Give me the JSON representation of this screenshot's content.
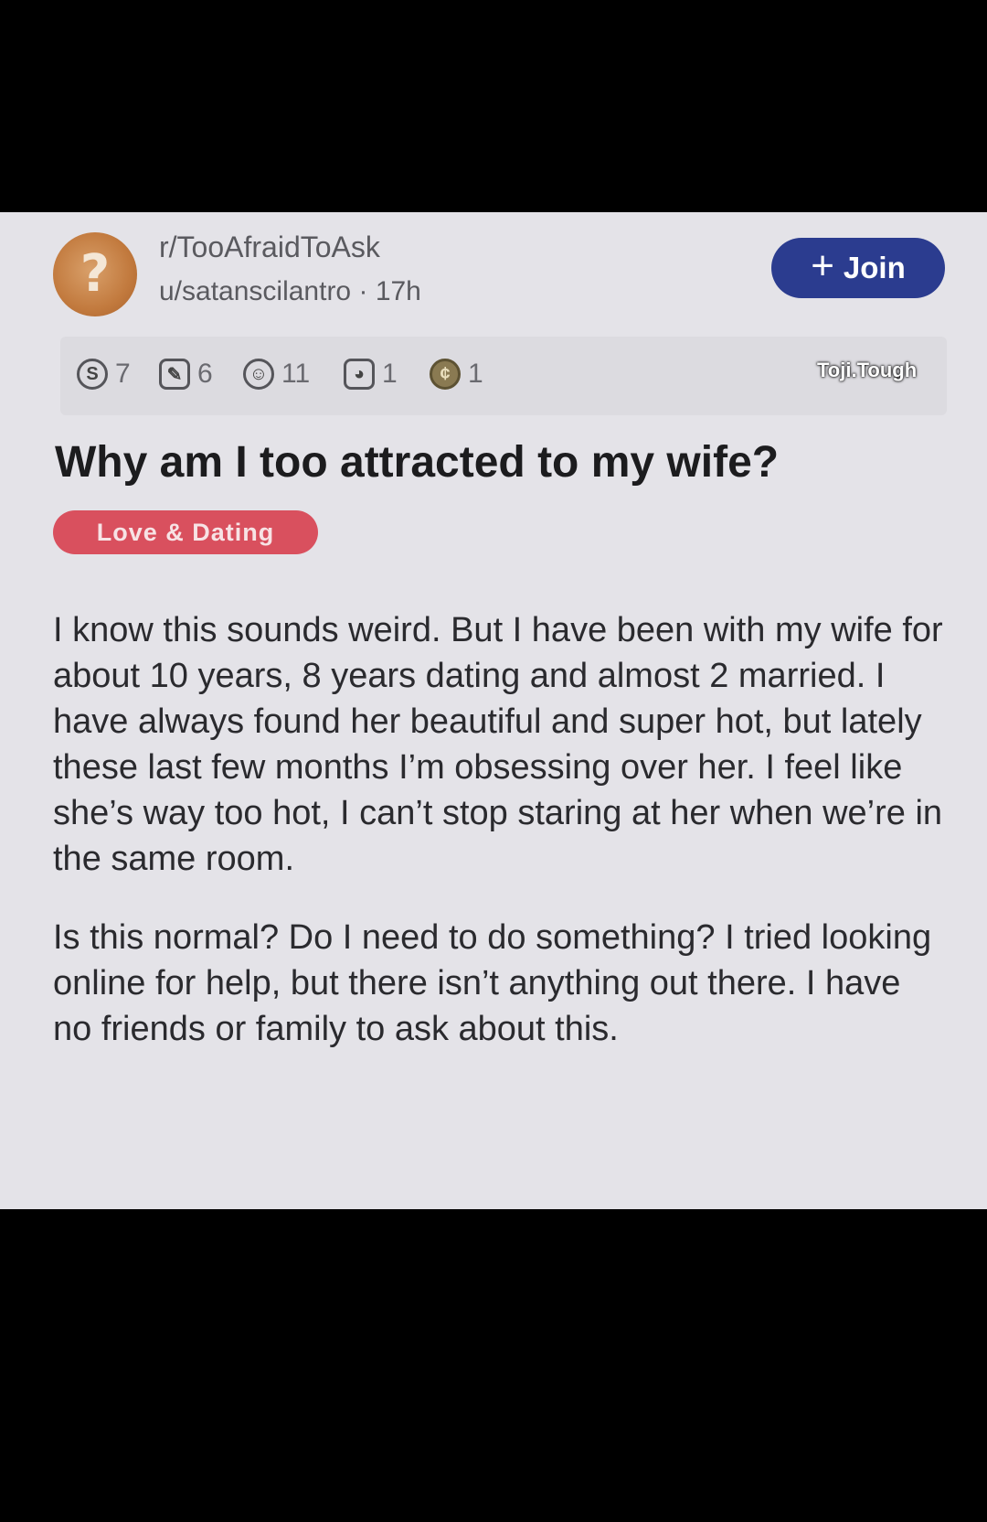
{
  "post": {
    "subreddit": "r/TooAfraidToAsk",
    "author": "u/satanscilantro",
    "separator": "·",
    "age": "17h",
    "join_label": "Join",
    "title": "Why am I too attracted to my wife?",
    "flair": "Love & Dating",
    "flair_color": "#d9505e",
    "paragraphs": [
      "I know this sounds weird. But I have been with my wife for about 10 years, 8 years dating and almost 2 married. I have always found her beautiful and super hot, but lately  these last few months I’m obsessing over her. I feel like she’s way too hot, I can’t stop staring at her when we’re in the same room.",
      "Is this normal? Do I need to do something? I tried looking online for help, but there isn’t anything out there. I have no friends or family to ask about this."
    ]
  },
  "awards": [
    {
      "icon": "silver-award-icon",
      "count": "7"
    },
    {
      "icon": "helpful-award-icon",
      "count": "6"
    },
    {
      "icon": "wholesome-award-icon",
      "count": "11"
    },
    {
      "icon": "doge-award-icon",
      "count": "1"
    },
    {
      "icon": "gold-coin-icon",
      "count": "1"
    }
  ],
  "watermark": "Toji.Tough",
  "colors": {
    "join_button": "#2b3c8f",
    "card_background": "#e4e3e8",
    "frame": "#000000"
  }
}
